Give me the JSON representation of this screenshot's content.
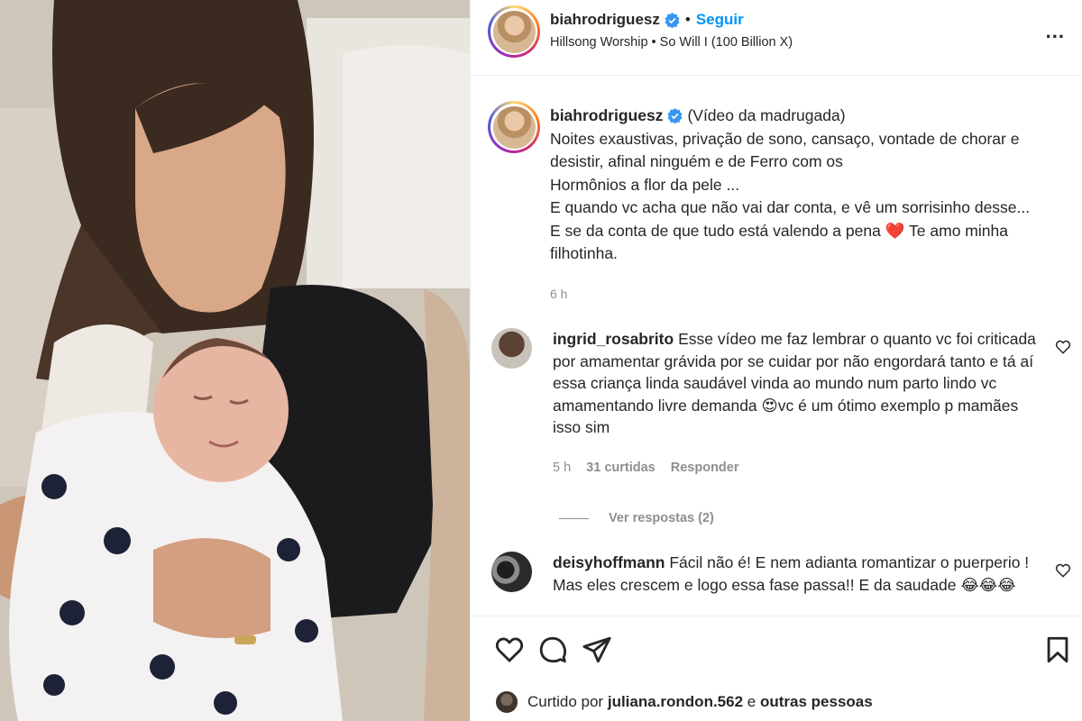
{
  "header": {
    "username": "biahrodriguesz",
    "separator": "•",
    "follow_label": "Seguir",
    "audio": "Hillsong Worship • So Will I (100 Billion X)",
    "more_label": "..."
  },
  "caption": {
    "username": "biahrodriguesz",
    "line1": "(Vídeo da madrugada)",
    "line2": "Noites exaustivas, privação de sono, cansaço, vontade de chorar e",
    "line3": "desistir, afinal ninguém e de Ferro com os",
    "line4": "Hormônios a flor da pele ...",
    "line5": "E quando vc acha que não vai dar conta, e vê um sorrisinho desse...",
    "line6a": "E se da conta de que tudo está valendo a pena",
    "heart": "❤️",
    "line6b": "Te amo minha",
    "line7": "filhotinha.",
    "time": "6 h"
  },
  "comments": [
    {
      "username": "ingrid_rosabrito",
      "text": "Esse vídeo me faz lembrar o quanto vc foi criticada por amamentar grávida por se cuidar por não engordará tanto e tá aí essa criança linda saudável vinda ao mundo num parto lindo vc amamentando livre demanda 😍vc é um ótimo exemplo p mamães isso sim",
      "time": "5 h",
      "likes": "31 curtidas",
      "reply": "Responder",
      "view_replies": "Ver respostas (2)"
    },
    {
      "username": "deisyhoffmann",
      "text": "Fácil não é! E nem adianta romantizar o puerperio ! Mas eles crescem e logo essa fase passa!! E da saudade 😂😂😂"
    }
  ],
  "likes": {
    "prefix": "Curtido por",
    "user": "juliana.rondon.562",
    "connector": "e",
    "others": "outras pessoas"
  },
  "colors": {
    "accent": "#0095f6",
    "muted": "#8e8e8e",
    "verified": "#3897f0"
  }
}
